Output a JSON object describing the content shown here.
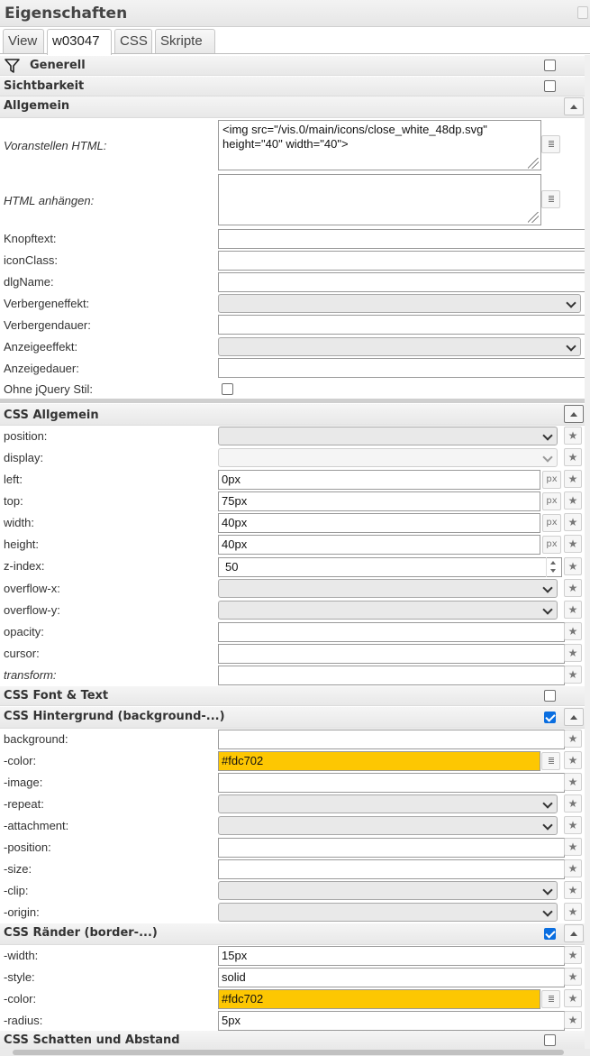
{
  "title": "Eigenschaften",
  "tabs": [
    "View",
    "w03047",
    "CSS",
    "Skripte"
  ],
  "sections": {
    "generell": "Generell",
    "sichtbarkeit": "Sichtbarkeit",
    "allgemein": "Allgemein",
    "css_allgemein": "CSS Allgemein",
    "css_font": "CSS Font & Text",
    "css_bg": "CSS Hintergrund (background-...)",
    "css_border": "CSS Ränder (border-...)",
    "css_shadow": "CSS Schatten und Abstand"
  },
  "allgemein": {
    "prepend_label": "Voranstellen HTML:",
    "prepend_value": "<img src=\"/vis.0/main/icons/close_white_48dp.svg\"\nheight=\"40\" width=\"40\">",
    "append_label": "HTML anhängen:",
    "append_value": "",
    "knopftext": "Knopftext:",
    "iconclass": "iconClass:",
    "dlgname": "dlgName:",
    "verbergeneffekt": "Verbergeneffekt:",
    "verbergendauer": "Verbergendauer:",
    "anzeigeeffekt": "Anzeigeeffekt:",
    "anzeigedauer": "Anzeigedauer:",
    "ohne_jquery": "Ohne jQuery Stil:"
  },
  "css_allgemein": {
    "position": "position:",
    "display": "display:",
    "left": "left:",
    "left_val": "0px",
    "top": "top:",
    "top_val": "75px",
    "width": "width:",
    "width_val": "40px",
    "height": "height:",
    "height_val": "40px",
    "zindex": "z-index:",
    "zindex_val": "50",
    "overflowx": "overflow-x:",
    "overflowy": "overflow-y:",
    "opacity": "opacity:",
    "cursor": "cursor:",
    "transform": "transform:",
    "unit": "px"
  },
  "css_bg": {
    "background": "background:",
    "color": "-color:",
    "color_val": "#fdc702",
    "image": "-image:",
    "repeat": "-repeat:",
    "attachment": "-attachment:",
    "position": "-position:",
    "size": "-size:",
    "clip": "-clip:",
    "origin": "-origin:"
  },
  "css_border": {
    "width": "-width:",
    "width_val": "15px",
    "style": "-style:",
    "style_val": "solid",
    "color": "-color:",
    "color_val": "#fdc702",
    "radius": "-radius:",
    "radius_val": "5px"
  },
  "colors": {
    "accent": "#fdc702",
    "check": "#0a6ee0"
  },
  "icons": {
    "filter": "filter-icon",
    "star": "star-icon",
    "dots": "color-picker-icon"
  }
}
